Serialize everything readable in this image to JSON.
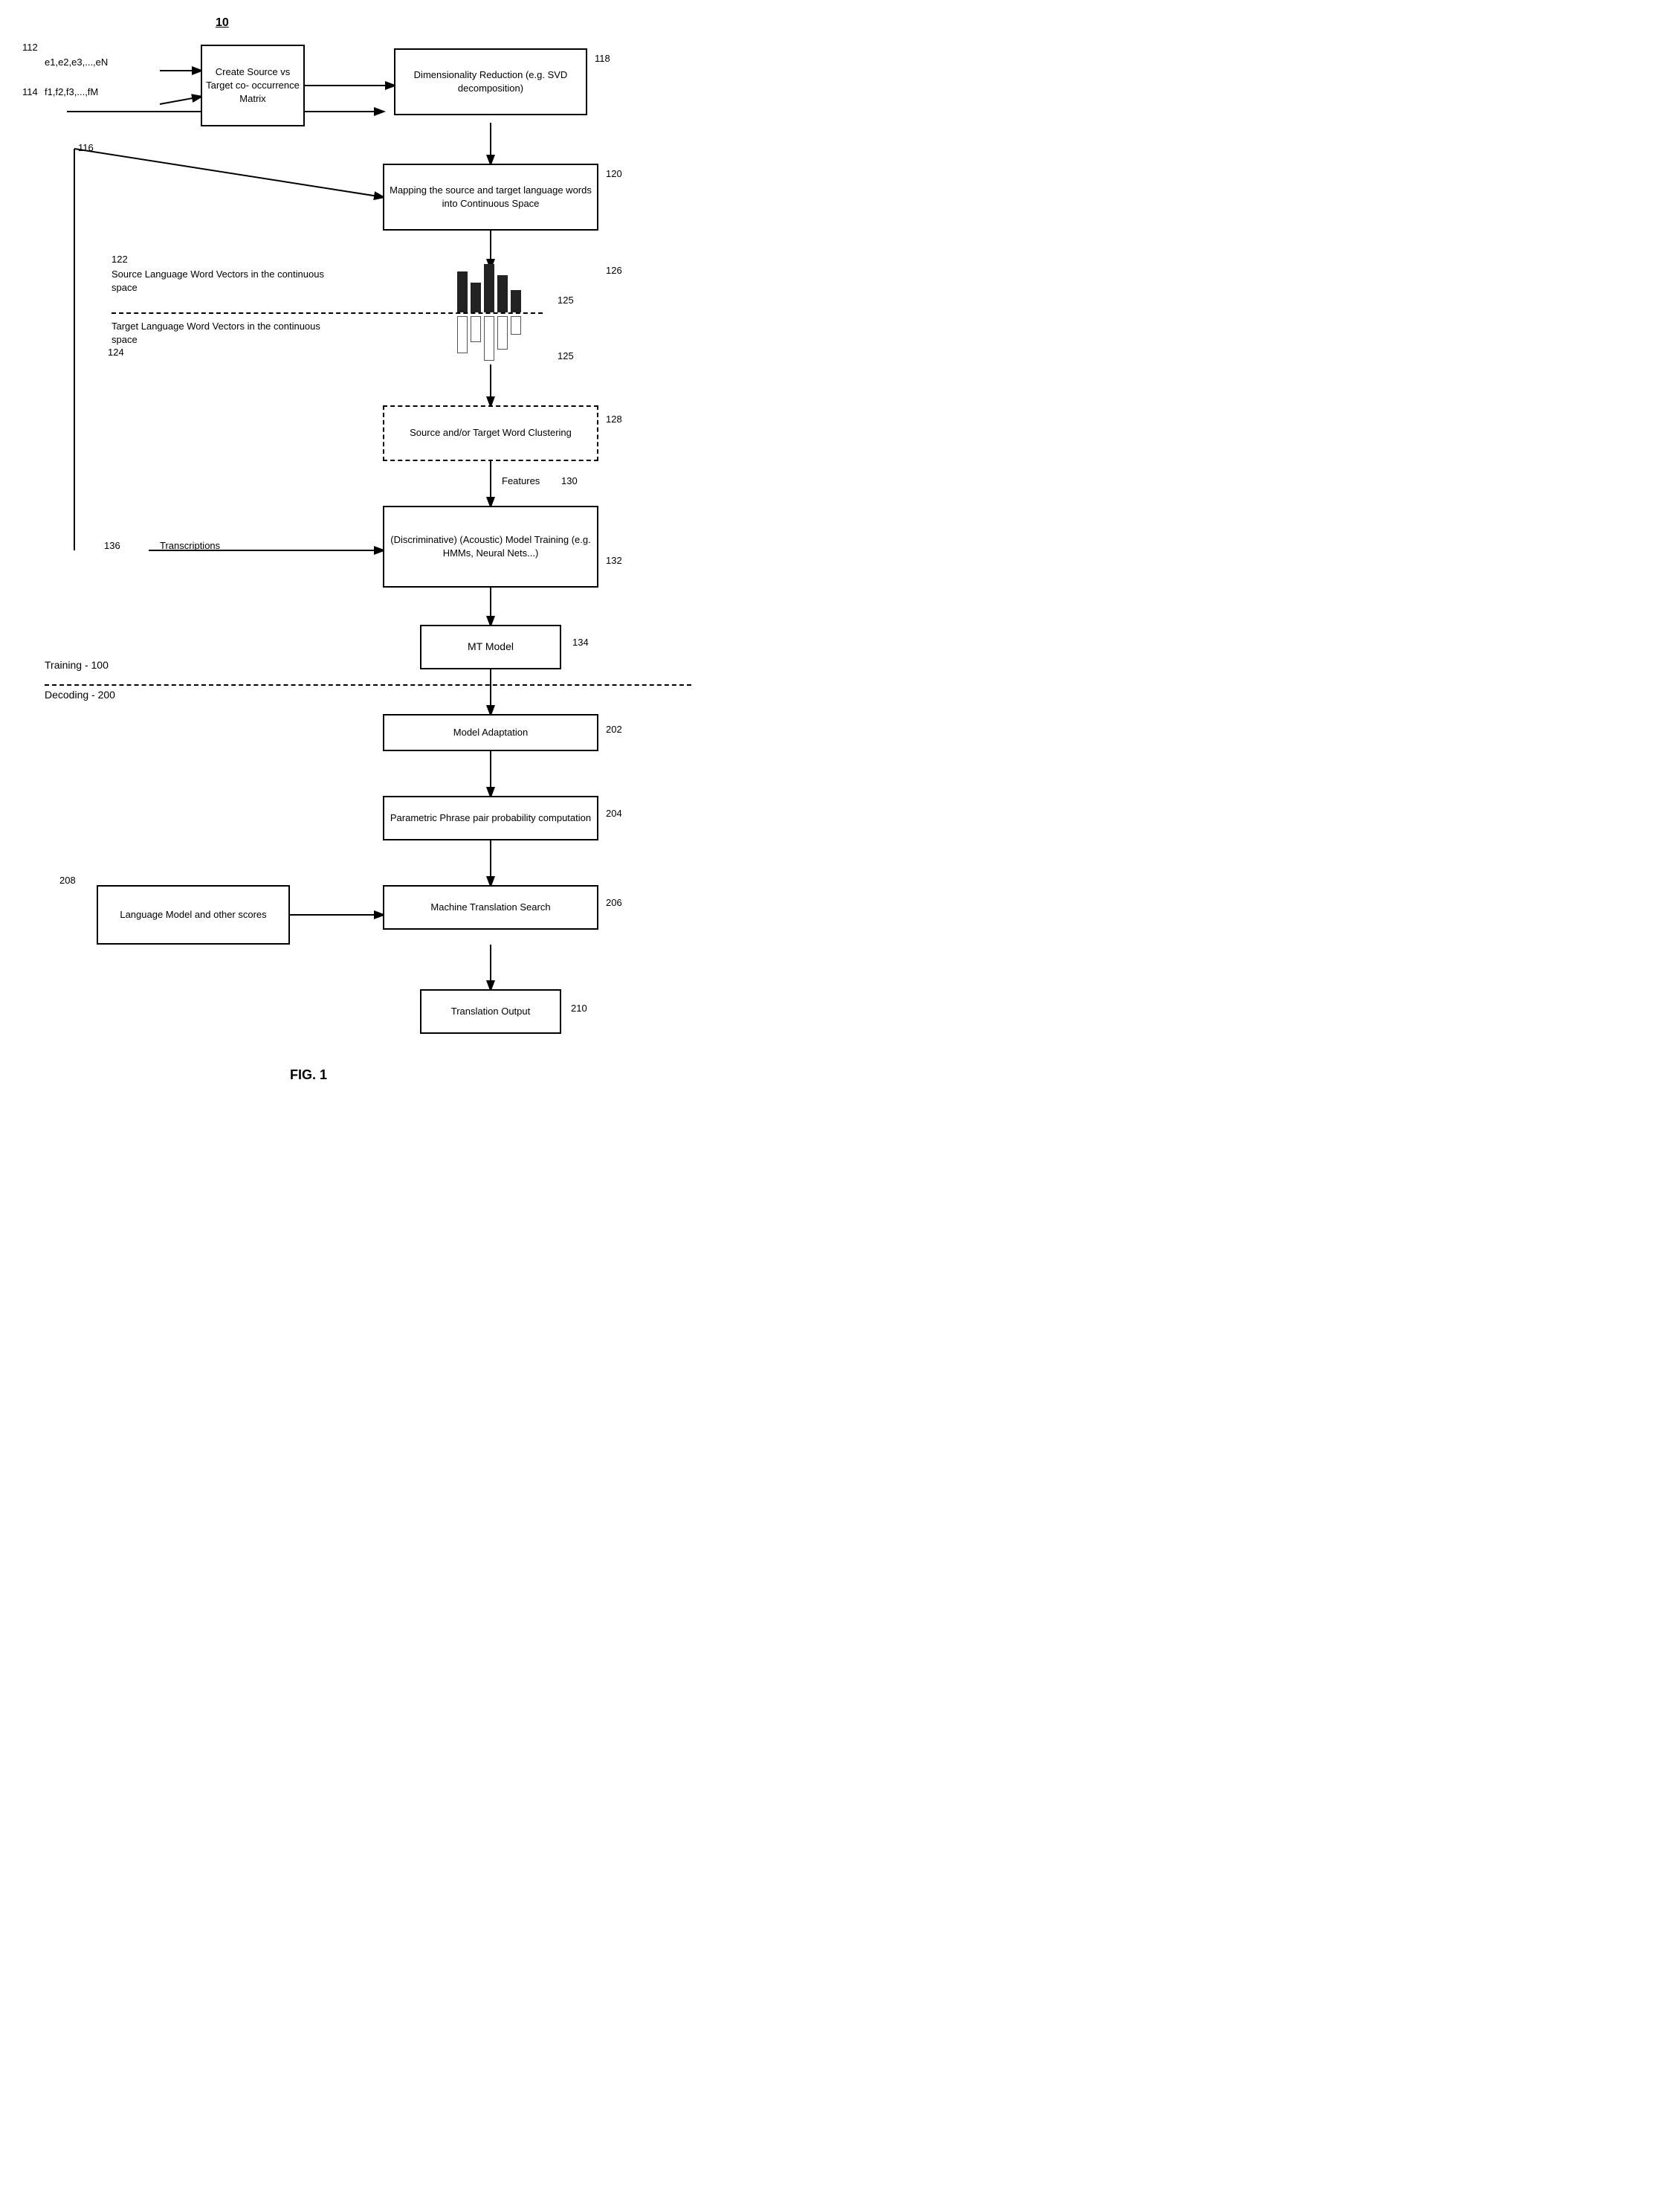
{
  "diagram": {
    "title": "10",
    "fig_label": "FIG. 1",
    "boxes": {
      "create_matrix": {
        "label": "Create Source vs\nTarget co-\noccurrence Matrix",
        "ref": "112"
      },
      "dimensionality": {
        "label": "Dimensionality\nReduction (e.g. SVD\ndecomposition)",
        "ref": "118"
      },
      "mapping": {
        "label": "Mapping the source and\ntarget language words into\nContinuous Space",
        "ref": "120"
      },
      "clustering": {
        "label": "Source and/or Target\nWord Clustering",
        "ref": "128"
      },
      "model_training": {
        "label": "(Discriminative) (Acoustic)\nModel Training\n(e.g. HMMs, Neural Nets...)",
        "ref": "132"
      },
      "mt_model": {
        "label": "MT Model",
        "ref": "134"
      },
      "model_adaptation": {
        "label": "Model Adaptation",
        "ref": "202"
      },
      "parametric": {
        "label": "Parametric Phrase pair\nprobability computation",
        "ref": "204"
      },
      "language_model": {
        "label": "Language Model and\nother scores",
        "ref": "208"
      },
      "mt_search": {
        "label": "Machine Translation Search",
        "ref": "206"
      },
      "translation_output": {
        "label": "Translation Output",
        "ref": "210"
      }
    },
    "labels": {
      "ref_10": "10",
      "ref_112": "112",
      "ref_114": "114",
      "ref_116": "116",
      "ref_118": "118",
      "ref_120": "120",
      "ref_122": "122",
      "ref_124": "124",
      "ref_125a": "125",
      "ref_125b": "125",
      "ref_126": "126",
      "ref_128": "128",
      "ref_130": "130",
      "ref_132": "132",
      "ref_134": "134",
      "ref_136": "136",
      "ref_202": "202",
      "ref_204": "204",
      "ref_206": "206",
      "ref_208": "208",
      "ref_210": "210",
      "source_lang_vec": "Source Language Word Vectors in the\ncontinuous space",
      "target_lang_vec": "Target Language Word Vectors in the\ncontinuous space",
      "transcriptions": "Transcriptions",
      "features": "Features",
      "training_label": "Training - 100",
      "decoding_label": "Decoding - 200",
      "e_vars": "e1,e2,e3,...,eN",
      "f_vars": "f1,f2,f3,...,fM"
    }
  }
}
